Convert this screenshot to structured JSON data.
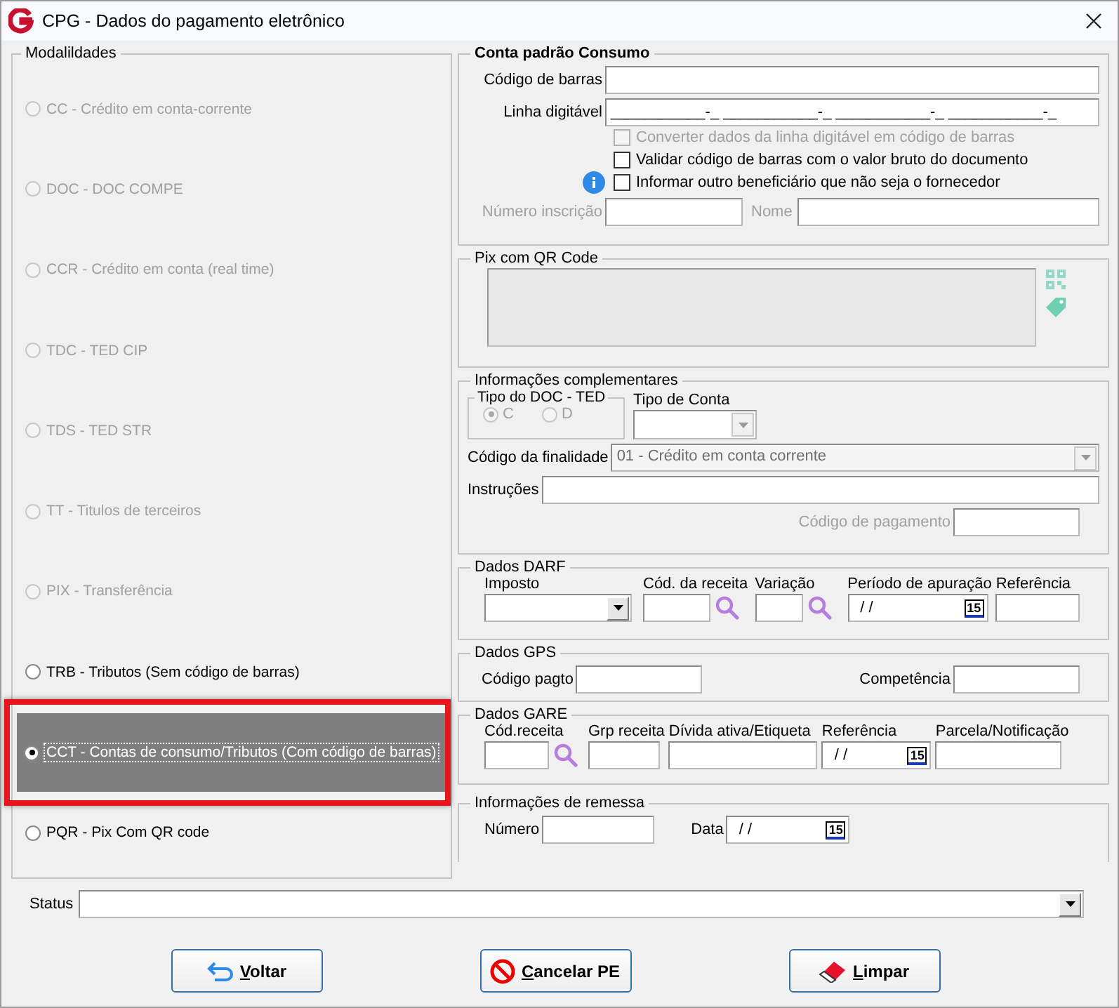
{
  "window": {
    "title": "CPG - Dados do pagamento eletrônico"
  },
  "modalidades": {
    "title": "Modalildades",
    "items": [
      {
        "label": "CC  - Crédito em conta-corrente",
        "disabled": true,
        "selected": false,
        "outlined": false
      },
      {
        "label": "DOC - DOC COMPE",
        "disabled": true,
        "selected": false,
        "outlined": false
      },
      {
        "label": "CCR - Crédito em conta (real time)",
        "disabled": true,
        "selected": false,
        "outlined": false
      },
      {
        "label": "TDC - TED CIP",
        "disabled": true,
        "selected": false,
        "outlined": false
      },
      {
        "label": "TDS - TED STR",
        "disabled": true,
        "selected": false,
        "outlined": false
      },
      {
        "label": "TT  - Titulos de terceiros",
        "disabled": true,
        "selected": false,
        "outlined": false
      },
      {
        "label": "PIX - Transferência",
        "disabled": true,
        "selected": false,
        "outlined": false
      },
      {
        "label": "TRB - Tributos (Sem código de barras)",
        "disabled": false,
        "selected": false,
        "outlined": false
      },
      {
        "label": "CCT - Contas de consumo/Tributos (Com código de barras)",
        "disabled": false,
        "selected": true,
        "outlined": true
      },
      {
        "label": "PQR - Pix Com QR code",
        "disabled": false,
        "selected": false,
        "outlined": false
      }
    ]
  },
  "conta_padrao": {
    "title": "Conta padrão Consumo",
    "codigo_barras_label": "Código de barras",
    "linha_digitavel_label": "Linha digitável",
    "linha_digitavel_value": "___________-_ ___________-_ ___________-_ ___________-_",
    "checks": [
      {
        "label": "Converter dados da linha digitável em código de barras",
        "checked": false,
        "disabled": true,
        "info": false
      },
      {
        "label": "Validar código de barras com o valor bruto do documento",
        "checked": false,
        "disabled": false,
        "info": false
      },
      {
        "label": "Informar outro beneficiário que não seja o fornecedor",
        "checked": false,
        "disabled": false,
        "info": true
      }
    ],
    "numero_inscricao": {
      "label": "Número inscrição",
      "disabled": true
    },
    "nome": {
      "label": "Nome",
      "disabled": true
    }
  },
  "pix_qr": {
    "title": "Pix com QR Code"
  },
  "info_complementares": {
    "title": "Informações complementares",
    "tipo_doc_ted": {
      "title": "Tipo do DOC - TED",
      "options": [
        {
          "label": "C",
          "selected": true,
          "disabled": true
        },
        {
          "label": "D",
          "selected": false,
          "disabled": true
        }
      ]
    },
    "tipo_conta_label": "Tipo de Conta",
    "codigo_finalidade_label": "Código da finalidade",
    "codigo_finalidade_value": "01 - Crédito em conta corrente",
    "instrucoes_label": "Instruções",
    "codigo_pagamento": {
      "label": "Código de pagamento",
      "disabled": true
    }
  },
  "darf": {
    "title": "Dados DARF",
    "fields": [
      {
        "label": "Imposto",
        "kind": "select"
      },
      {
        "label": "Cód. da receita",
        "kind": "lookup"
      },
      {
        "label": "Variação",
        "kind": "lookup"
      },
      {
        "label": "Período de apuração",
        "kind": "date",
        "value": "/ /",
        "button": "15"
      },
      {
        "label": "Referência",
        "kind": "text"
      }
    ]
  },
  "gps": {
    "title": "Dados GPS",
    "fields": [
      {
        "label": "Código pagto"
      },
      {
        "label": "Competência"
      }
    ]
  },
  "gare": {
    "title": "Dados GARE",
    "fields": [
      {
        "label": "Cód.receita",
        "kind": "lookup"
      },
      {
        "label": "Grp receita",
        "kind": "text"
      },
      {
        "label": "Dívida ativa/Etiqueta",
        "kind": "text"
      },
      {
        "label": "Referência",
        "kind": "date",
        "value": "/ /",
        "button": "15"
      },
      {
        "label": "Parcela/Notificação",
        "kind": "text"
      }
    ]
  },
  "remessa": {
    "title": "Informações de remessa",
    "fields": [
      {
        "label": "Número",
        "kind": "text"
      },
      {
        "label": "Data",
        "kind": "date",
        "value": "/ /",
        "button": "15"
      }
    ]
  },
  "status": {
    "label": "Status"
  },
  "buttons": [
    {
      "label": "Voltar"
    },
    {
      "label": "Cancelar PE"
    },
    {
      "label": "Limpar"
    }
  ]
}
